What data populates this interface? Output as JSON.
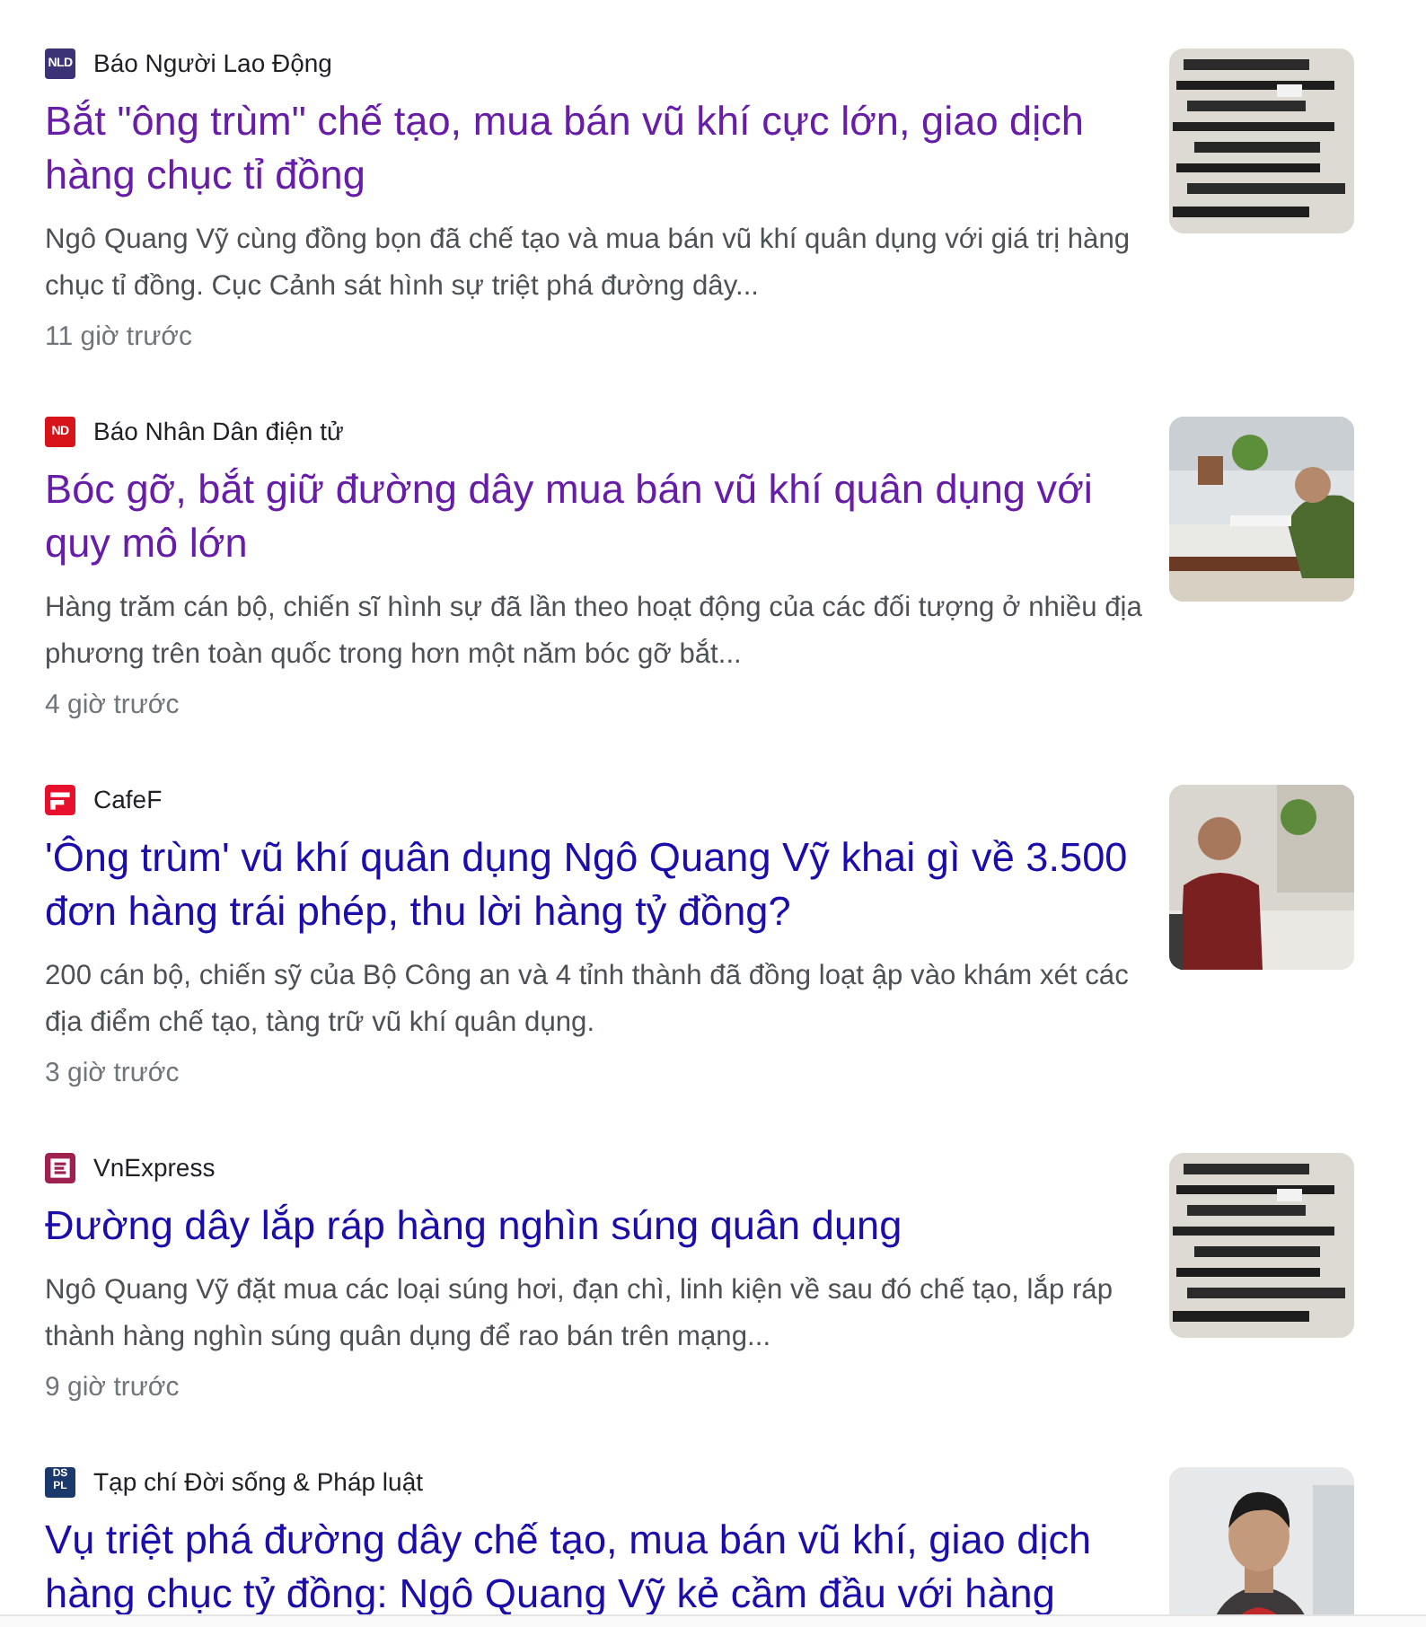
{
  "results": [
    {
      "source": {
        "name": "Báo Người Lao Động",
        "logo": {
          "kind": "letters",
          "text": "NLD",
          "color": "#3b3376"
        }
      },
      "title": "Bắt \"ông trùm\" chế tạo, mua bán vũ khí cực lớn, giao dịch hàng chục tỉ đồng",
      "visited": true,
      "snippet": "Ngô Quang Vỹ cùng đồng bọn đã chế tạo và mua bán vũ khí quân dụng với giá trị hàng chục tỉ đồng. Cục Cảnh sát hình sự triệt phá đường dây...",
      "time": "11 giờ trước"
    },
    {
      "source": {
        "name": "Báo Nhân Dân điện tử",
        "logo": {
          "kind": "letters",
          "text": "ND",
          "color": "#d7141a"
        }
      },
      "title": "Bóc gỡ, bắt giữ đường dây mua bán vũ khí quân dụng với quy mô lớn",
      "visited": true,
      "snippet": "Hàng trăm cán bộ, chiến sĩ hình sự đã lần theo hoạt động của các đối tượng ở nhiều địa phương trên toàn quốc trong hơn một năm bóc gỡ bắt...",
      "time": "4 giờ trước"
    },
    {
      "source": {
        "name": "CafeF",
        "logo": {
          "kind": "bars",
          "color": "#e8112d"
        }
      },
      "title": "'Ông trùm' vũ khí quân dụng Ngô Quang Vỹ khai gì về 3.500 đơn hàng trái phép, thu lời hàng tỷ đồng?",
      "visited": false,
      "snippet": "200 cán bộ, chiến sỹ của Bộ Công an và 4 tỉnh thành đã đồng loạt ập vào khám xét các địa điểm chế tạo, tàng trữ vũ khí quân dụng.",
      "time": "3 giờ trước"
    },
    {
      "source": {
        "name": "VnExpress",
        "logo": {
          "kind": "frame",
          "color": "#9f224e"
        }
      },
      "title": "Đường dây lắp ráp hàng nghìn súng quân dụng",
      "visited": false,
      "snippet": "Ngô Quang Vỹ đặt mua các loại súng hơi, đạn chì, linh kiện về sau đó chế tạo, lắp ráp thành hàng nghìn súng quân dụng để rao bán trên mạng...",
      "time": "9 giờ trước"
    },
    {
      "source": {
        "name": "Tạp chí Đời sống & Pháp luật",
        "logo": {
          "kind": "grid",
          "text": "DSPL",
          "color": "#1b3a6b"
        }
      },
      "title": "Vụ triệt phá đường dây chế tạo, mua bán vũ khí, giao dịch hàng chục tỷ đồng: Ngô Quang Vỹ kẻ cầm đầu với hàng",
      "visited": false
    }
  ]
}
